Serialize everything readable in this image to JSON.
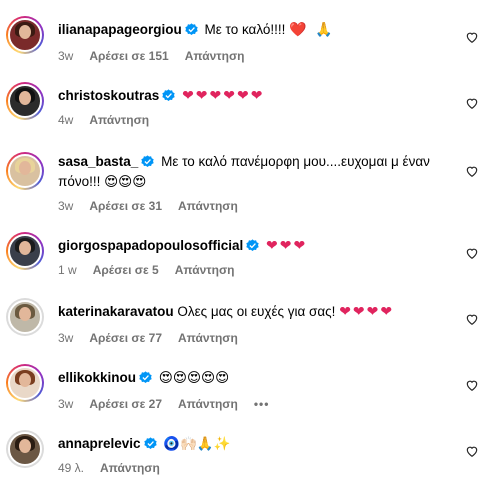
{
  "comments": [
    {
      "username": "ilianapapageorgiou",
      "text": "Με το καλό!!!!",
      "emoji": "❤️ 🙏",
      "time": "3w",
      "likes": "Αρέσει σε 151",
      "reply": "Απάντηση",
      "avatar": {
        "ring": true,
        "bg": "#7a2a2a",
        "hair": "#3a1a12"
      }
    },
    {
      "username": "christoskoutras",
      "text": "",
      "emoji": "❤❤❤❤❤❤",
      "time": "4w",
      "likes": "",
      "reply": "Απάντηση",
      "avatar": {
        "ring": true,
        "bg": "#2b2b2b",
        "hair": "#111111"
      }
    },
    {
      "username": "sasa_basta_",
      "text": "Με το καλό πανέμορφη μου....ευχομαι μ έναν πόνο!!!",
      "emoji": "😍😍😍",
      "time": "3w",
      "likes": "Αρέσει σε 31",
      "reply": "Απάντηση",
      "avatar": {
        "ring": true,
        "bg": "#d9c1a0",
        "hair": "#e8d39a"
      }
    },
    {
      "username": "giorgospapadopoulosofficial",
      "text": "",
      "emoji": "❤❤❤",
      "time": "1 w",
      "likes": "Αρέσει σε 5",
      "reply": "Απάντηση",
      "avatar": {
        "ring": true,
        "bg": "#3a3f4a",
        "hair": "#1c1c1c"
      }
    },
    {
      "username": "katerinakaravatou",
      "text": "Ολες μας οι ευχές για σας!",
      "emoji": "❤❤❤❤",
      "time": "3w",
      "likes": "Αρέσει σε 77",
      "reply": "Απάντηση",
      "avatar": {
        "ring": false,
        "bg": "#bfb8a8",
        "hair": "#6b5a40"
      }
    },
    {
      "username": "ellikokkinou",
      "text": "",
      "emoji": "😍😍😍😍😍",
      "time": "3w",
      "likes": "Αρέσει σε 27",
      "reply": "Απάντηση",
      "more": "•••",
      "avatar": {
        "ring": true,
        "bg": "#e9d8c8",
        "hair": "#7a3e20"
      }
    },
    {
      "username": "annaprelevic",
      "text": "",
      "emoji": "🧿🙌🏻🙏✨",
      "time": "49 λ.",
      "likes": "",
      "reply": "Απάντηση",
      "avatar": {
        "ring": false,
        "bg": "#6b5744",
        "hair": "#2a1c12"
      }
    }
  ],
  "colors": {
    "verified": "#0095f6",
    "meta": "#737373",
    "heart_emoji": "#e0245e"
  },
  "icons": {
    "like": "heart-outline-icon",
    "verified": "verified-badge-icon",
    "more": "more-options-icon"
  }
}
